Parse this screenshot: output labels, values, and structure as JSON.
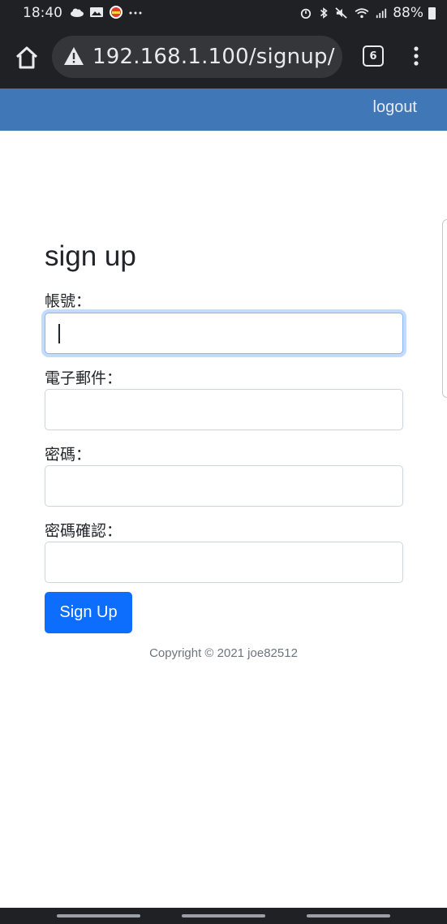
{
  "status_bar": {
    "time": "18:40",
    "battery": "88%",
    "left_icons": [
      "cloud-icon",
      "image-icon",
      "app-badge-icon",
      "more-dots-icon"
    ],
    "right_icons": [
      "alarm-icon",
      "bluetooth-icon",
      "mute-icon",
      "wifi-icon",
      "signal-icon",
      "battery-icon"
    ]
  },
  "browser": {
    "url": "192.168.1.100/signup/",
    "tab_count": "6",
    "chrome_color": "#202124",
    "pill_color": "#35363a"
  },
  "navbar": {
    "logout_label": "logout",
    "color": "#4077b7"
  },
  "form": {
    "title": "sign up",
    "username_label": "帳號：",
    "email_label": "電子郵件：",
    "password_label": "密碼：",
    "password_confirm_label": "密碼確認：",
    "username_value": "",
    "email_value": "",
    "password_value": "",
    "password_confirm_value": "",
    "submit_label": "Sign Up",
    "submit_color": "#0d6efd"
  },
  "footer": {
    "copyright": "Copyright © 2021 joe82512"
  }
}
